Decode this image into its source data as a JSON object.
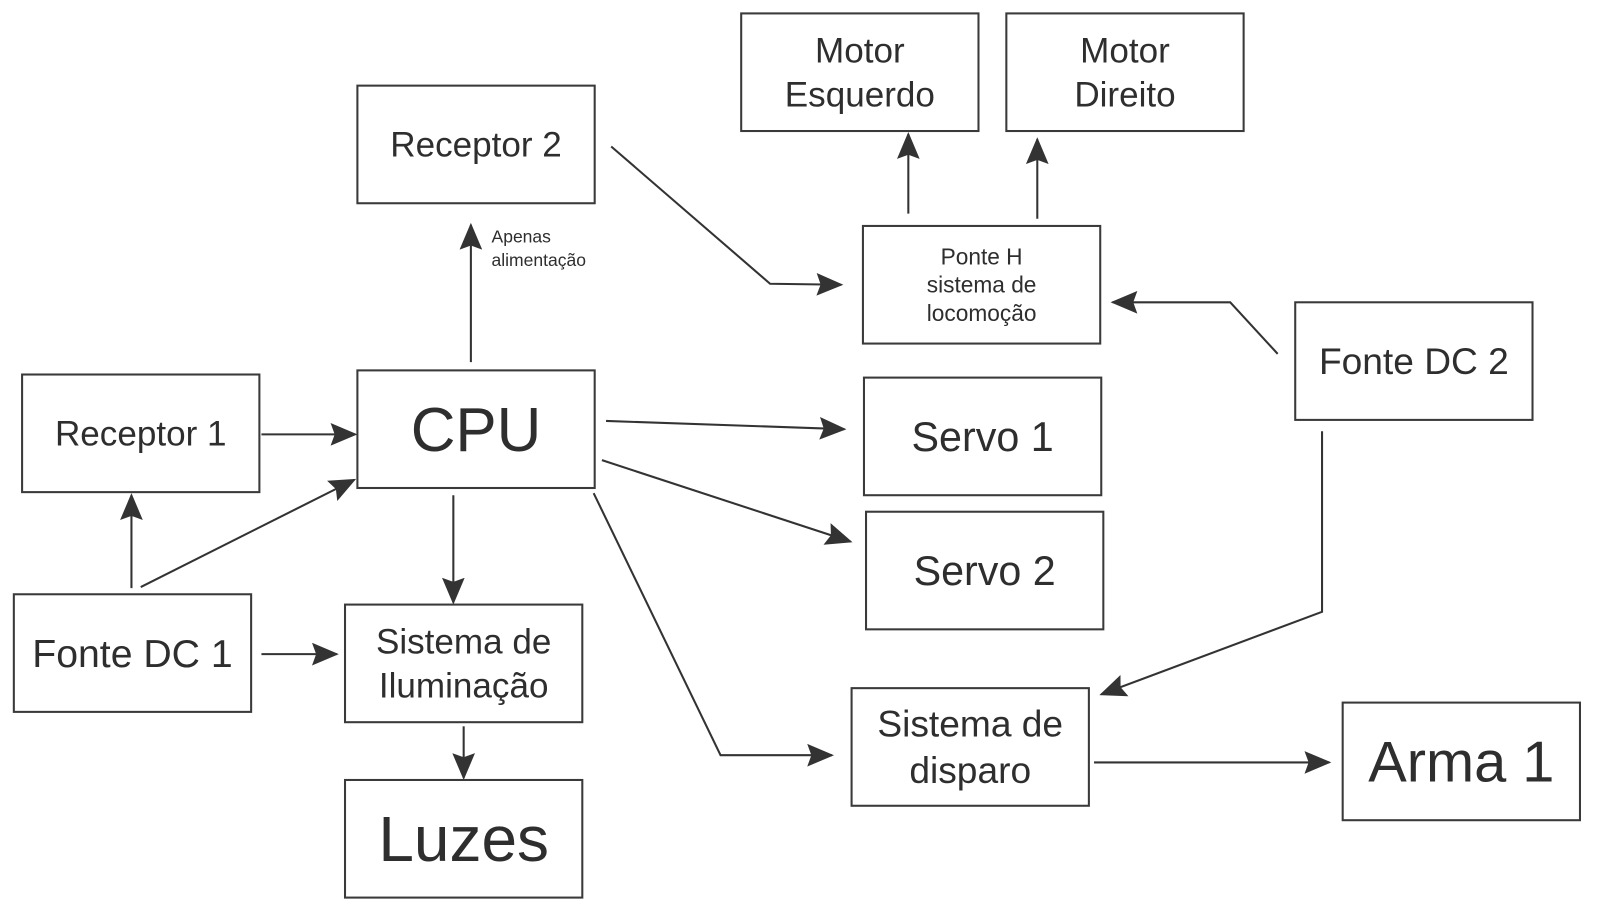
{
  "colors": {
    "stroke": "#3a3a3a",
    "text": "#2e2e2e",
    "background": "#ffffff"
  },
  "boxes": {
    "motor_esquerdo": [
      "Motor",
      "Esquerdo"
    ],
    "motor_direito": [
      "Motor",
      "Direito"
    ],
    "receptor2": [
      "Receptor 2"
    ],
    "ponte_h": [
      "Ponte H",
      "sistema de",
      "locomoção"
    ],
    "fonte_dc2": [
      "Fonte DC 2"
    ],
    "receptor1": [
      "Receptor 1"
    ],
    "cpu": [
      "CPU"
    ],
    "servo1": [
      "Servo 1"
    ],
    "servo2": [
      "Servo 2"
    ],
    "fonte_dc1": [
      "Fonte DC 1"
    ],
    "iluminacao": [
      "Sistema de",
      "Iluminação"
    ],
    "disparo": [
      "Sistema de",
      "disparo"
    ],
    "arma1": [
      "Arma 1"
    ],
    "luzes": [
      "Luzes"
    ]
  },
  "annotation": [
    "Apenas",
    "alimentação"
  ]
}
